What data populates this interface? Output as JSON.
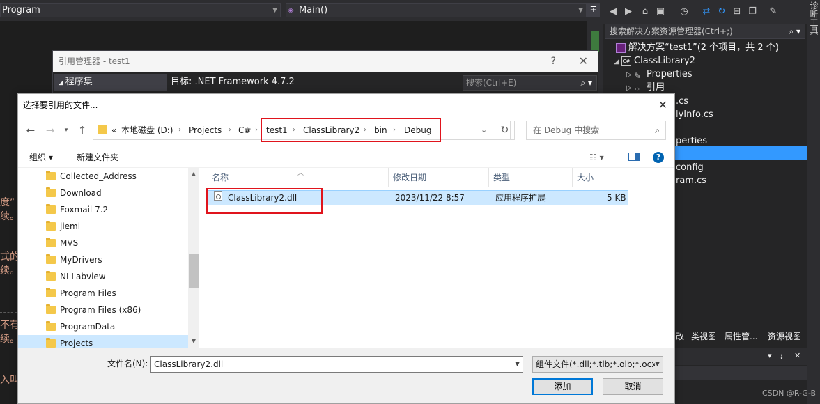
{
  "vs": {
    "top_combo_left": "Program",
    "top_combo_right": "Main()",
    "split_glyph": "∓",
    "code_fragments": [
      "度”",
      "续。",
      "式的",
      "续。",
      "不有",
      "续。",
      "入叫"
    ],
    "solution_explorer": {
      "search_placeholder": "搜索解决方案资源管理器(Ctrl+;)",
      "solution": "解决方案“test1”(2 个项目，共 2 个)",
      "project": "ClassLibrary2",
      "properties": "Properties",
      "references": "引用",
      "visible_fragments": [
        ".cs",
        "lyInfo.cs",
        "perties",
        "config",
        "ram.cs"
      ],
      "csproj_badge": "C#"
    },
    "bottom_tabs": [
      "改",
      "类视图",
      "属性管...",
      "资源视图"
    ],
    "prop_bar_icons": [
      "▾",
      "⭭",
      "✕"
    ],
    "vertical_strip_text": "诊断工具",
    "watermark": "CSDN @R-G-B"
  },
  "reference_manager": {
    "title": "引用管理器 - test1",
    "help": "?",
    "close": "✕",
    "tab": "程序集",
    "target": "目标: .NET Framework 4.7.2",
    "search_placeholder": "搜索(Ctrl+E)"
  },
  "dialog": {
    "title": "选择要引用的文件...",
    "close": "✕",
    "address": {
      "overflow": "«",
      "segments": [
        "本地磁盘 (D:)",
        "Projects",
        "C#",
        "test1",
        "ClassLibrary2",
        "bin",
        "Debug"
      ]
    },
    "search_placeholder": "在 Debug 中搜索",
    "toolbar": {
      "organize": "组织 ▾",
      "new_folder": "新建文件夹"
    },
    "tree": [
      "Collected_Address",
      "Download",
      "Foxmail 7.2",
      "jiemi",
      "MVS",
      "MyDrivers",
      "NI Labview",
      "Program Files",
      "Program Files (x86)",
      "ProgramData",
      "Projects"
    ],
    "tree_selected_index": 10,
    "columns": [
      "名称",
      "修改日期",
      "类型",
      "大小"
    ],
    "files": [
      {
        "name": "ClassLibrary2.dll",
        "date": "2023/11/22 8:57",
        "type": "应用程序扩展",
        "size": "5 KB"
      }
    ],
    "filename_label": "文件名(N):",
    "filename_value": "ClassLibrary2.dll",
    "filetype_value": "组件文件(*.dll;*.tlb;*.olb;*.ocx;",
    "add_button": "添加",
    "cancel_button": "取消"
  },
  "colors": {
    "vs_bg": "#1e1e1e",
    "vs_selection": "#3399ff",
    "highlight_red": "#e0141d",
    "file_selected": "#cce8ff",
    "folder": "#f4c84a"
  }
}
